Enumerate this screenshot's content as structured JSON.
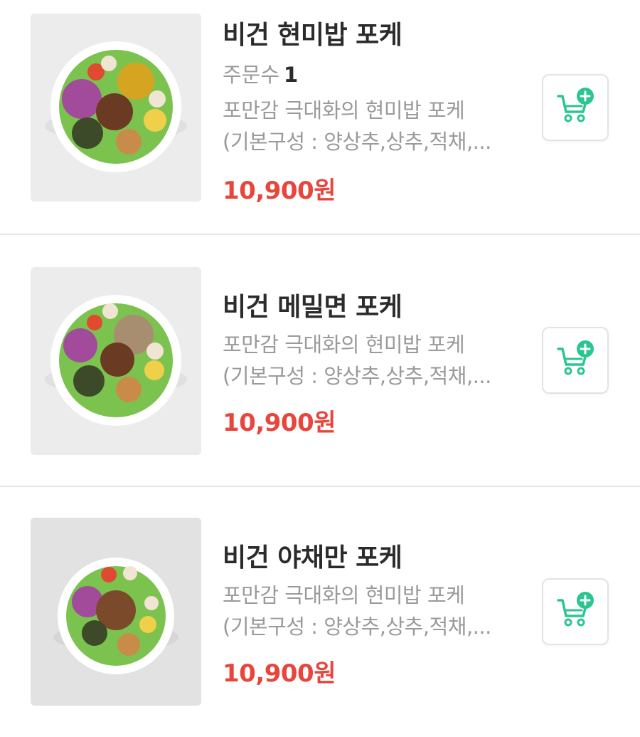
{
  "items": [
    {
      "name": "비건 현미밥 포케",
      "orders_label": "주문수",
      "orders_count": "1",
      "desc_line1": "포만감 극대화의 현미밥 포케",
      "desc_line2": "(기본구성 : 양상추,상추,적채,...",
      "price": "10,900원",
      "image_icon": "poke-bowl-image"
    },
    {
      "name": "비건 메밀면 포케",
      "desc_line1": "포만감 극대화의 현미밥 포케",
      "desc_line2": "(기본구성 : 양상추,상추,적채,...",
      "price": "10,900원",
      "image_icon": "poke-bowl-image"
    },
    {
      "name": "비건 야채만 포케",
      "desc_line1": "포만감 극대화의 현미밥 포케",
      "desc_line2": "(기본구성 : 양상추,상추,적채,...",
      "price": "10,900원",
      "image_icon": "poke-bowl-image"
    }
  ],
  "cart_icon": "cart-add-icon",
  "colors": {
    "price": "#e8453c",
    "cart": "#2bc592",
    "divider": "#e6e6e6"
  }
}
